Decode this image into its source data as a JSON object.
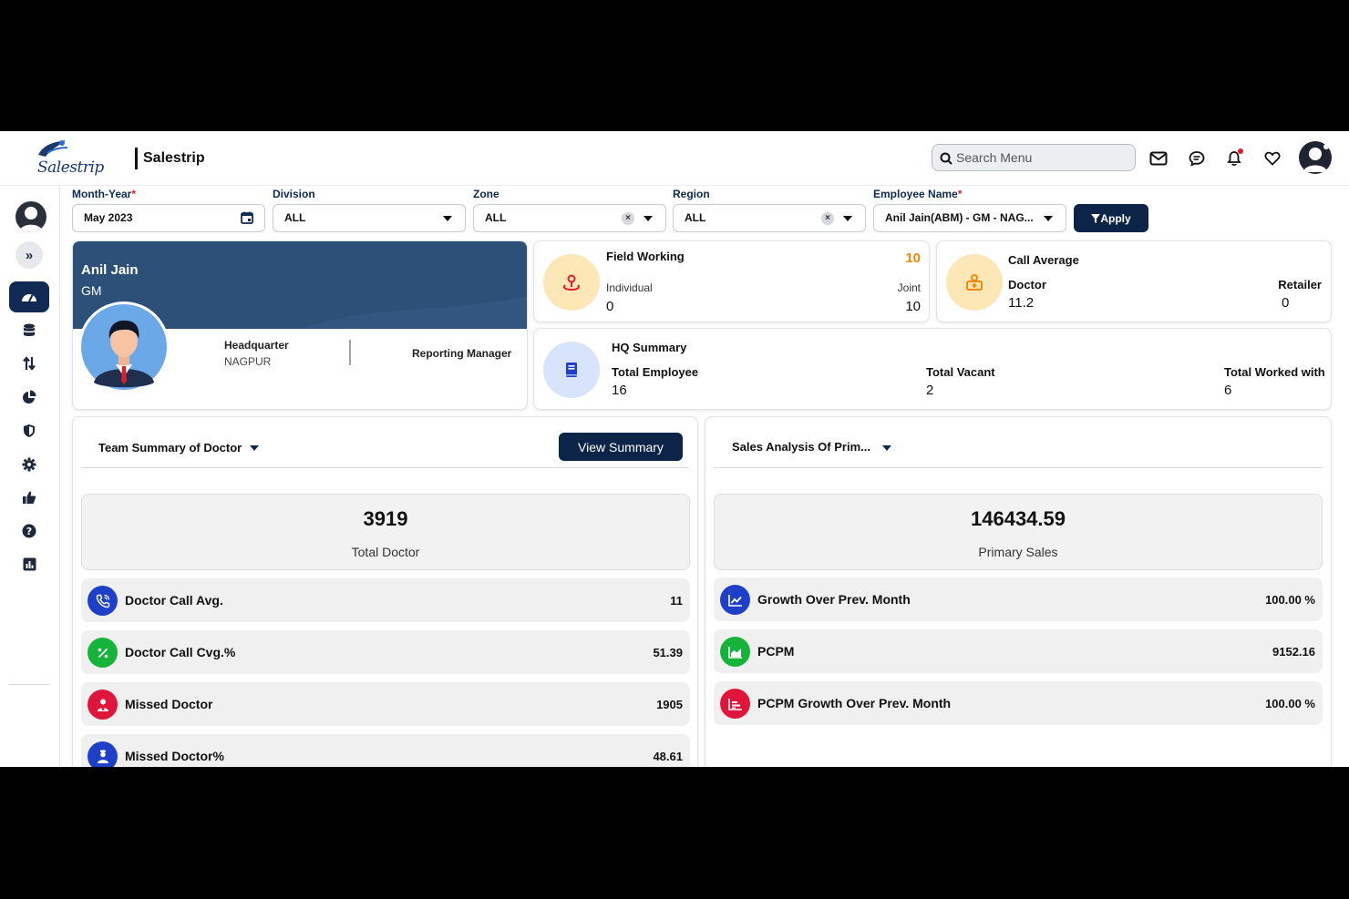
{
  "header": {
    "logo_text": "Salestrip",
    "app_title": "Salestrip",
    "search_placeholder": "Search Menu"
  },
  "filters": {
    "month_year": {
      "label": "Month-Year",
      "value": "May 2023"
    },
    "division": {
      "label": "Division",
      "value": "ALL"
    },
    "zone": {
      "label": "Zone",
      "value": "ALL"
    },
    "region": {
      "label": "Region",
      "value": "ALL"
    },
    "employee": {
      "label": "Employee Name",
      "value": "Anil Jain(ABM) - GM - NAG..."
    },
    "apply_label": "Apply"
  },
  "profile": {
    "name": "Anil Jain",
    "role": "GM",
    "hq_label": "Headquarter",
    "hq_value": "NAGPUR",
    "manager_label": "Reporting Manager"
  },
  "field_working": {
    "title": "Field Working",
    "total": "10",
    "individual_label": "Individual",
    "individual_value": "0",
    "joint_label": "Joint",
    "joint_value": "10"
  },
  "call_average": {
    "title": "Call Average",
    "doctor_label": "Doctor",
    "doctor_value": "11.2",
    "retailer_label": "Retailer",
    "retailer_value": "0"
  },
  "hq_summary": {
    "title": "HQ Summary",
    "total_employee_label": "Total Employee",
    "total_employee_value": "16",
    "total_vacant_label": "Total Vacant",
    "total_vacant_value": "2",
    "total_worked_label": "Total Worked with",
    "total_worked_value": "6"
  },
  "team_summary": {
    "title": "Team Summary of Doctor",
    "view_button": "View Summary",
    "total_value": "3919",
    "total_label": "Total Doctor",
    "rows": [
      {
        "label": "Doctor Call Avg.",
        "value": "11",
        "icon": "phone-icon",
        "color": "#1e40c8"
      },
      {
        "label": "Doctor Call Cvg.%",
        "value": "51.39",
        "icon": "percent-icon",
        "color": "#16b33a"
      },
      {
        "label": "Missed Doctor",
        "value": "1905",
        "icon": "doctor-icon",
        "color": "#e0153c"
      },
      {
        "label": "Missed Doctor%",
        "value": "48.61",
        "icon": "doctor-icon",
        "color": "#1e40c8"
      }
    ]
  },
  "sales_analysis": {
    "title": "Sales Analysis Of Prim...",
    "total_value": "146434.59",
    "total_label": "Primary Sales",
    "rows": [
      {
        "label": "Growth Over Prev. Month",
        "value": "100.00 %",
        "icon": "line-chart-icon",
        "color": "#1e40c8"
      },
      {
        "label": "PCPM",
        "value": "9152.16",
        "icon": "area-chart-icon",
        "color": "#16b33a"
      },
      {
        "label": "PCPM Growth Over Prev. Month",
        "value": "100.00 %",
        "icon": "bar-chart-icon",
        "color": "#e0153c"
      }
    ]
  },
  "colors": {
    "navy": "#0c2447",
    "profile_band": "#2d5079",
    "accent_orange": "#f08a00"
  }
}
